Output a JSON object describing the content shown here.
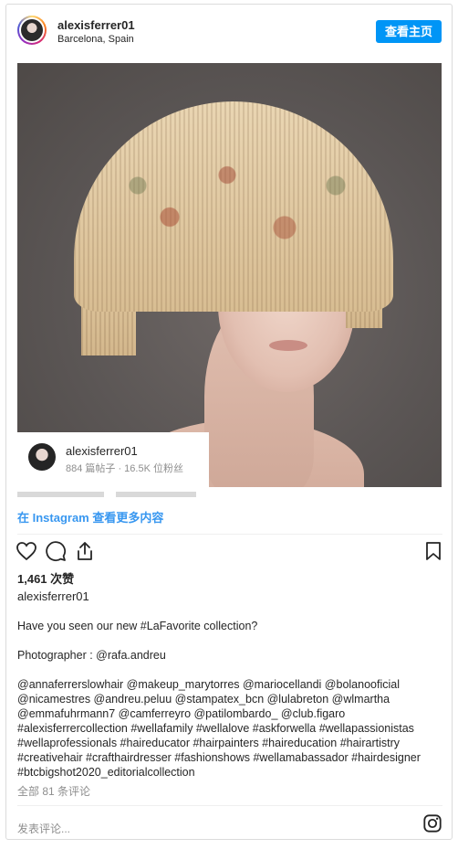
{
  "header": {
    "username": "alexisferrer01",
    "location": "Barcelona, Spain",
    "view_profile": "查看主页"
  },
  "profile_card": {
    "username": "alexisferrer01",
    "stats": "884 篇帖子 · 16.5K 位粉丝"
  },
  "more_link": "在 Instagram 查看更多内容",
  "likes": "1,461 次赞",
  "caption": {
    "username": "alexisferrer01",
    "line1": "Have you seen our new #LaFavorite collection?",
    "line2": "Photographer : @rafa.andreu",
    "tags": "@annaferrerslowhair @makeup_marytorres @mariocellandi @bolanooficial\n@nicamestres @andreu.peluu @stampatex_bcn @lulabreton @wlmartha\n@emmafuhrmann7 @camferreyro @patilombardo_ @club.figaro\n#alexisferrercollection #wellafamily #wellalove #askforwella #wellapassionistas\n#wellaprofessionals #haireducator #hairpainters #haireducation #hairartistry\n#creativehair #crafthairdresser #fashionshows #wellamabassador #hairdesigner\n#btcbigshot2020_editorialcollection"
  },
  "comments_label": "全部 81 条评论",
  "comment_placeholder": "发表评论...",
  "icons": [
    "heart-icon",
    "comment-icon",
    "share-icon",
    "bookmark-icon",
    "instagram-icon"
  ],
  "colors": {
    "accent": "#0095f6",
    "link": "#3897f0",
    "muted": "#8e8e8e"
  }
}
